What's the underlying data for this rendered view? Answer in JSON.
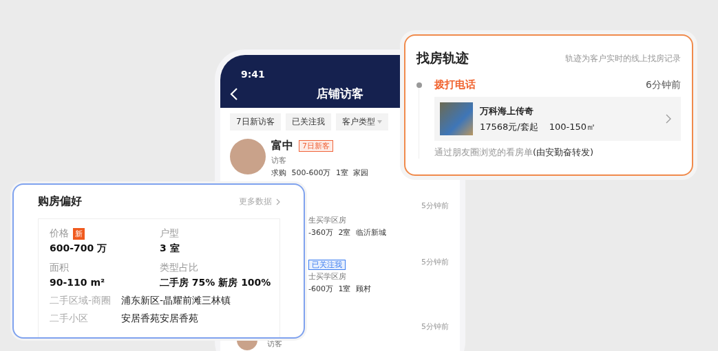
{
  "phone": {
    "status_time": "9:41",
    "title": "店铺访客",
    "filters": [
      {
        "label": "7日新访客",
        "dropdown": false
      },
      {
        "label": "已关注我",
        "dropdown": false
      },
      {
        "label": "客户类型",
        "dropdown": true
      }
    ],
    "visitors": [
      {
        "kind": "full",
        "name": "富中",
        "tag": {
          "label": "7日新客",
          "color": "#f0643a"
        },
        "role": "访客",
        "demand": "求购 500-600万 1室 家园"
      },
      {
        "kind": "partial",
        "time": "5分钟前",
        "lines": [
          "生买学区房",
          "-360万 2室 临沂新城"
        ]
      },
      {
        "kind": "partial",
        "tag": {
          "label": "已关注我",
          "color": "#3a7cf0"
        },
        "time": "5分钟前",
        "lines": [
          "士买学区房",
          "-600万 1室 顾村"
        ]
      },
      {
        "kind": "avatar",
        "role": "访客",
        "time": "5分钟前"
      }
    ]
  },
  "trail": {
    "title": "找房轨迹",
    "note": "轨迹为客户实时的线上找房记录",
    "events": [
      {
        "action": "拨打电话",
        "time": "6分钟前",
        "property": {
          "name": "万科海上传奇",
          "price": "17568元/套起",
          "area": "100-150㎡"
        },
        "source": "通过朋友圈浏览的看房单",
        "forwarder": "(由安勤奋转发)"
      }
    ]
  },
  "preference": {
    "title": "购房偏好",
    "more": "更多数据",
    "stats": [
      {
        "label": "价格",
        "badge": "新",
        "value": "600-700 万"
      },
      {
        "label": "户型",
        "value": "3 室"
      },
      {
        "label": "面积",
        "value": "90-110 m²"
      },
      {
        "label": "类型占比",
        "value": "二手房 75% 新房 100%"
      }
    ],
    "details": [
      {
        "label": "二手区域-商圈",
        "value": "浦东新区-晶耀前滩三林镇"
      },
      {
        "label": "二手小区",
        "value": "安居香苑安居香苑"
      }
    ]
  }
}
